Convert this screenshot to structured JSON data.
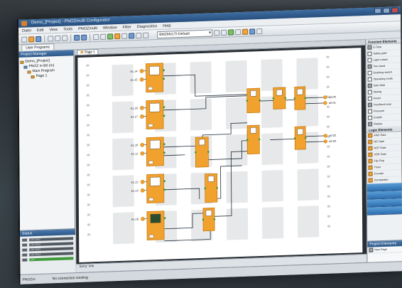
{
  "window": {
    "title": "Demo_[Project] - PNOZmulti Configurator"
  },
  "menu": [
    "Datei",
    "Edit",
    "View",
    "Tools",
    "PNOZmulti",
    "Window",
    "Filter",
    "Diagnostics",
    "Help"
  ],
  "toolbar": {
    "combo_value": "BMZMULTI-Default"
  },
  "tabs": {
    "user_programs": "User Programs"
  },
  "project_manager": {
    "title": "Project Manager",
    "tree": [
      {
        "label": "Demo_[Project]",
        "level": 0,
        "icon": "project-icon"
      },
      {
        "label": "PNOZ m B0 (m)",
        "level": 1,
        "icon": "device-icon"
      },
      {
        "label": "Main Program",
        "level": 2,
        "icon": "program-icon"
      },
      {
        "label": "Page 1",
        "level": 3,
        "icon": "page-icon"
      }
    ]
  },
  "status_panel": {
    "title": "Status",
    "rows": [
      "OK 0001",
      "OK 0002",
      "OK 0003",
      "OK 0004",
      "ON"
    ]
  },
  "editor": {
    "tab": "Page 1",
    "inputs": [
      {
        "id": "a1",
        "labels": [
          "e1.14",
          "e1.15"
        ]
      },
      {
        "id": "a2",
        "labels": [
          "e1.16",
          "e1.17"
        ]
      },
      {
        "id": "a3",
        "labels": [
          "e1.10",
          "e1.11"
        ]
      },
      {
        "id": "a4",
        "labels": [
          "e1.12",
          "e1.13"
        ]
      },
      {
        "id": "a5",
        "labels": [
          "e1.18"
        ]
      }
    ],
    "outputs": [
      {
        "id": "o1",
        "labels": [
          "o0.00",
          "o0.01"
        ]
      },
      {
        "id": "o2",
        "labels": [
          "o0.02",
          "o0.03"
        ]
      }
    ],
    "message_bar": "Sorry: Info"
  },
  "palette": {
    "sections": [
      {
        "title": "Function Elements",
        "items": [
          "E-Stop",
          "Safety gate",
          "Light curtain",
          "Two-hand",
          "Enabling switch",
          "Operating mode",
          "Safe Wait",
          "Muting",
          "Reset",
          "Feedback loop",
          "Pressure",
          "Enable",
          "Startup"
        ]
      },
      {
        "title": "Logic Elements",
        "items": [
          "AND Gate",
          "OR Gate",
          "NOT Gate",
          "XOR Gate",
          "Flip-Flop",
          "Timer",
          "Counter",
          "Comparator"
        ]
      }
    ],
    "bottom_title": "Project Elements",
    "bottom_item": "New Page"
  },
  "statusbar": {
    "left": "PNOZm",
    "right": "No connection existing"
  },
  "colors": {
    "block": "#f0a12e",
    "block_border": "#c97c12",
    "wire": "#1e2a35",
    "pin": "#2e9a3a",
    "slot": "#e6e8ea"
  }
}
